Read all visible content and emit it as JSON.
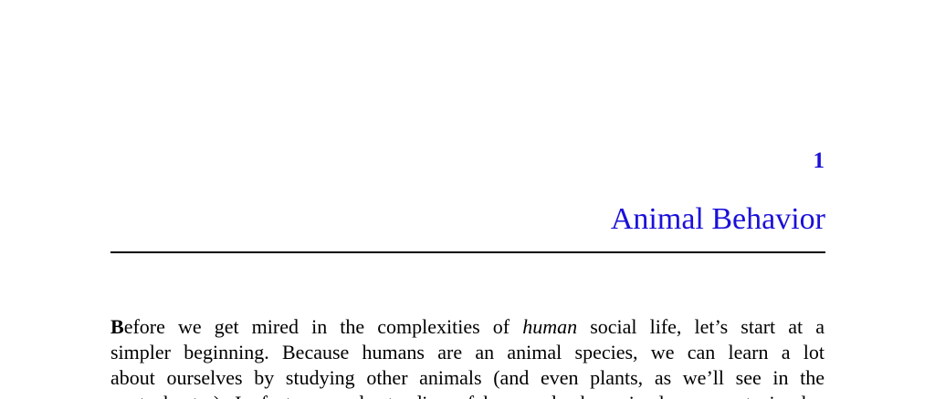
{
  "chapter": {
    "number": "1",
    "title": "Animal Behavior"
  },
  "paragraph": {
    "lines": [
      {
        "lead_bold": "B",
        "pre": "efore we get mired in the complexities of ",
        "italic": "human",
        "post": " social life, let’s start at a"
      },
      {
        "text": "simpler beginning. Because humans are an animal species, we can learn a lot"
      },
      {
        "text": "about ourselves by studying other animals (and even plants, as we’ll see in the"
      },
      {
        "text": "next chapter). In fact, an understanding of how and why animals cooperate is also"
      }
    ]
  }
}
